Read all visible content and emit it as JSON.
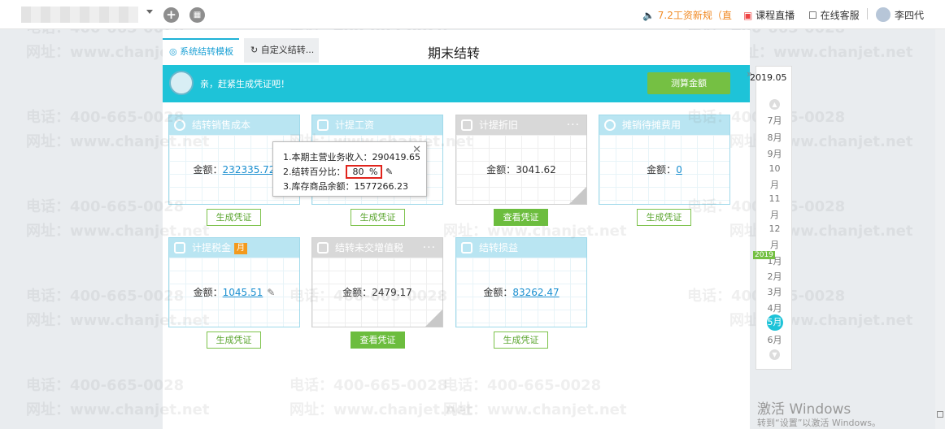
{
  "topbar": {
    "news": "7.2工资新规（直",
    "live": "课程直播",
    "service": "在线客服",
    "user": "李四代"
  },
  "tabs": [
    {
      "label": "系统结转模板"
    },
    {
      "label": "自定义结转..."
    }
  ],
  "page_title": "期末结转",
  "banner": {
    "message": "亲，赶紧生成凭证吧！",
    "calc_button": "测算金额"
  },
  "amount_label": "金额：",
  "cards": [
    {
      "title": "结转销售成本",
      "amount": "232335.72",
      "button": "生成凭证"
    },
    {
      "title": "计提工资",
      "amount": "",
      "button": "生成凭证"
    },
    {
      "title": "计提折旧",
      "amount": "3041.62",
      "button": "查看凭证"
    },
    {
      "title": "摊销待摊费用",
      "amount": "0",
      "button": "生成凭证"
    },
    {
      "title": "计提税金",
      "badge": "月",
      "amount": "1045.51",
      "button": "生成凭证"
    },
    {
      "title": "结转未交增值税",
      "amount": "2479.17",
      "button": "查看凭证"
    },
    {
      "title": "结转损益",
      "amount": "83262.47",
      "button": "生成凭证"
    }
  ],
  "popup": {
    "line1": "1.本期主营业务收入：290419.65",
    "line2_label": "2.结转百分比：",
    "percent_value": "80",
    "percent_unit": "%",
    "line3": "3.库存商品余额：1577266.23"
  },
  "calendar": {
    "year_label": "2019.05",
    "year_tag": "2019",
    "months_top": [
      "7月",
      "8月",
      "9月",
      "10",
      "月",
      "11",
      "月",
      "12",
      "月"
    ],
    "months_bottom": [
      "1月",
      "2月",
      "3月",
      "4月",
      "5月",
      "6月"
    ],
    "selected": "5月"
  },
  "watermark": {
    "phone": "电话：400-665-0028",
    "site": "网址：www.chanjet.net"
  },
  "activation": {
    "title": "激活 Windows",
    "subtitle": "转到“设置”以激活 Windows。"
  },
  "colors": {
    "accent": "#1ec3d8",
    "green": "#75c043",
    "orange": "#f08a24",
    "red": "#e1241c"
  }
}
